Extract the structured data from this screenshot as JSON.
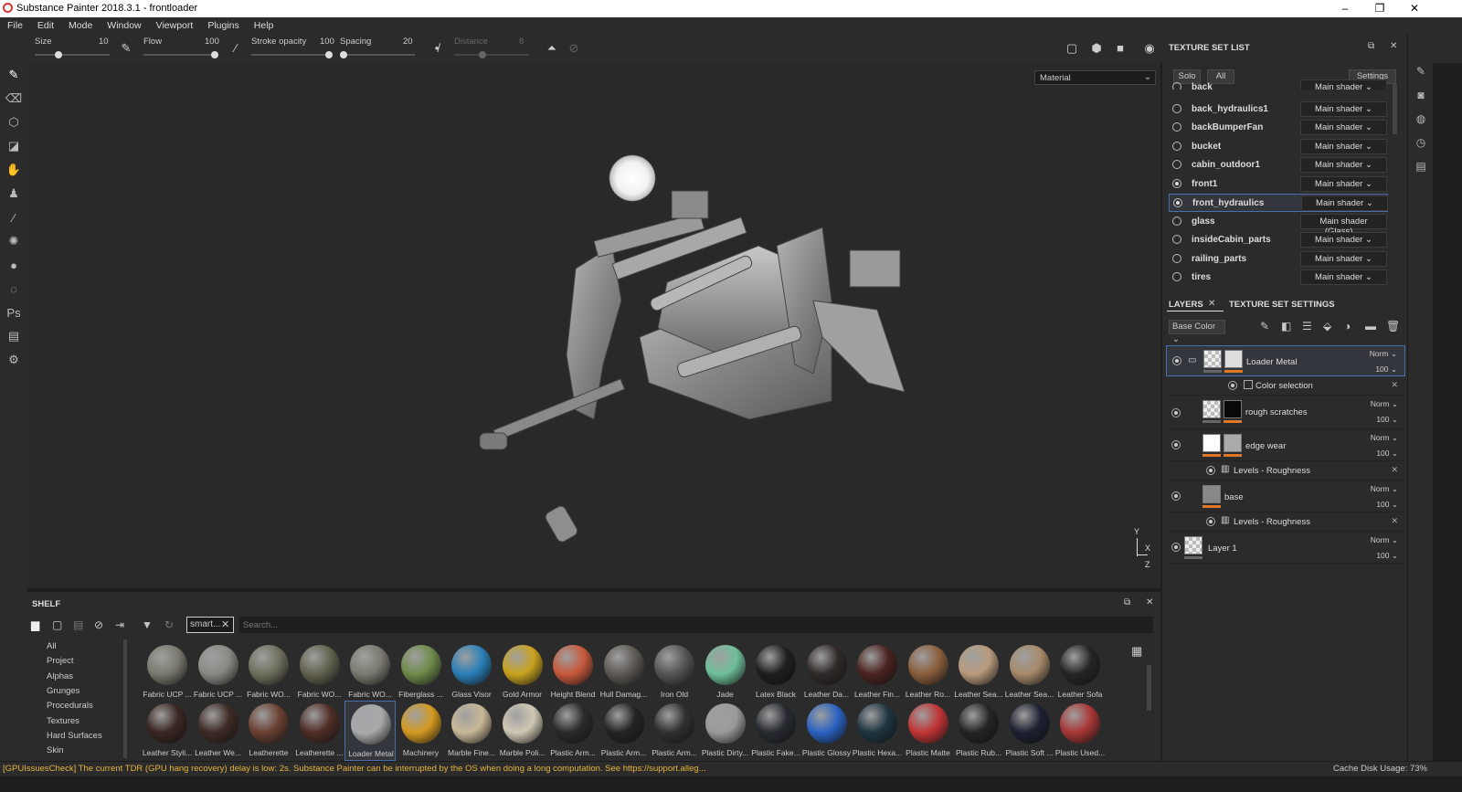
{
  "window": {
    "title": "Substance Painter 2018.3.1 - frontloader",
    "minimize": "–",
    "maximize": "❐",
    "close": "✕"
  },
  "menu": [
    "File",
    "Edit",
    "Mode",
    "Window",
    "Viewport",
    "Plugins",
    "Help"
  ],
  "toolbar": {
    "size_label": "Size",
    "size_value": "10",
    "flow_label": "Flow",
    "flow_value": "100",
    "stroke_label": "Stroke opacity",
    "stroke_value": "100",
    "spacing_label": "Spacing",
    "spacing_value": "20",
    "distance_label": "Distance",
    "distance_value": "8"
  },
  "viewport": {
    "mode": "Material"
  },
  "texture_set_list": {
    "title": "TEXTURE SET LIST",
    "solo": "Solo",
    "all": "All",
    "settings": "Settings",
    "items": [
      {
        "name": "back",
        "shader": "Main shader"
      },
      {
        "name": "back_hydraulics1",
        "shader": "Main shader"
      },
      {
        "name": "backBumperFan",
        "shader": "Main shader"
      },
      {
        "name": "bucket",
        "shader": "Main shader"
      },
      {
        "name": "cabin_outdoor1",
        "shader": "Main shader"
      },
      {
        "name": "front1",
        "shader": "Main shader"
      },
      {
        "name": "front_hydraulics",
        "shader": "Main shader"
      },
      {
        "name": "glass",
        "shader": "Main shader (Glass)"
      },
      {
        "name": "insideCabin_parts",
        "shader": "Main shader"
      },
      {
        "name": "railing_parts",
        "shader": "Main shader"
      },
      {
        "name": "tires",
        "shader": "Main shader"
      }
    ]
  },
  "layers": {
    "tab_layers": "LAYERS",
    "tab_tss": "TEXTURE SET SETTINGS",
    "channel": "Base Color",
    "rows": [
      {
        "name": "Loader Metal",
        "blend": "Norm",
        "opacity": "100"
      },
      {
        "name": "Color selection"
      },
      {
        "name": "rough scratches",
        "blend": "Norm",
        "opacity": "100"
      },
      {
        "name": "edge wear",
        "blend": "Norm",
        "opacity": "100"
      },
      {
        "name": "Levels - Roughness"
      },
      {
        "name": "base",
        "blend": "Norm",
        "opacity": "100"
      },
      {
        "name": "Levels - Roughness"
      },
      {
        "name": "Layer 1",
        "blend": "Norm",
        "opacity": "100"
      }
    ]
  },
  "shelf": {
    "title": "SHELF",
    "filter_tag": "smart...",
    "search_placeholder": "Search...",
    "categories": [
      "All",
      "Project",
      "Alphas",
      "Grunges",
      "Procedurals",
      "Textures",
      "Hard Surfaces",
      "Skin"
    ],
    "row1": [
      {
        "label": "Fabric UCP ...",
        "color": "#7a7a70"
      },
      {
        "label": "Fabric UCP ...",
        "color": "#8a8a84"
      },
      {
        "label": "Fabric WO...",
        "color": "#6f6f5e"
      },
      {
        "label": "Fabric WO...",
        "color": "#62624f"
      },
      {
        "label": "Fabric WO...",
        "color": "#7b7b72"
      },
      {
        "label": "Fiberglass ...",
        "color": "#6f8a4a"
      },
      {
        "label": "Glass Visor",
        "color": "#2a7fb8"
      },
      {
        "label": "Gold Armor",
        "color": "#c9a31e"
      },
      {
        "label": "Height Blend",
        "color": "#c8583c"
      },
      {
        "label": "Hull Damag...",
        "color": "#5e5a55"
      },
      {
        "label": "Iron Old",
        "color": "#555555"
      },
      {
        "label": "Jade",
        "color": "#6fbf9a"
      },
      {
        "label": "Latex Black",
        "color": "#1e1e1e"
      },
      {
        "label": "Leather Da...",
        "color": "#2f2a28"
      },
      {
        "label": "Leather Fin...",
        "color": "#4a2220"
      },
      {
        "label": "Leather Ro...",
        "color": "#8a5e3c"
      },
      {
        "label": "Leather Sea...",
        "color": "#b89a7c"
      },
      {
        "label": "Leather Sea...",
        "color": "#a68a6a"
      },
      {
        "label": "Leather Sofa",
        "color": "#252525"
      }
    ],
    "row2": [
      {
        "label": "Leather Styli...",
        "color": "#3a2622"
      },
      {
        "label": "Leather We...",
        "color": "#3e2a24"
      },
      {
        "label": "Leatherette",
        "color": "#6a4032"
      },
      {
        "label": "Leatherette ...",
        "color": "#4f2c26"
      },
      {
        "label": "Loader Metal",
        "color": "#a8a8a8"
      },
      {
        "label": "Machinery",
        "color": "#d49a20"
      },
      {
        "label": "Marble Fine...",
        "color": "#c8b898"
      },
      {
        "label": "Marble Poli...",
        "color": "#cfc8b4"
      },
      {
        "label": "Plastic Arm...",
        "color": "#2a2a2a"
      },
      {
        "label": "Plastic Arm...",
        "color": "#242424"
      },
      {
        "label": "Plastic Arm...",
        "color": "#303030"
      },
      {
        "label": "Plastic Dirty...",
        "color": "#9a9a9a"
      },
      {
        "label": "Plastic Fake...",
        "color": "#262a30"
      },
      {
        "label": "Plastic Glossy",
        "color": "#2a62c0"
      },
      {
        "label": "Plastic Hexa...",
        "color": "#1e3440"
      },
      {
        "label": "Plastic Matte",
        "color": "#c03434"
      },
      {
        "label": "Plastic Rub...",
        "color": "#242424"
      },
      {
        "label": "Plastic Soft ...",
        "color": "#1c2030"
      },
      {
        "label": "Plastic Used...",
        "color": "#a83636"
      }
    ]
  },
  "status": {
    "message": "[GPUIssuesCheck] The current TDR (GPU hang recovery) delay is low: 2s. Substance Painter can be interrupted by the OS when doing a long computation. See https://support.alleg...",
    "cache": "Cache Disk Usage:   73%"
  },
  "axis": {
    "y": "Y",
    "x": "X",
    "z": "Z"
  }
}
